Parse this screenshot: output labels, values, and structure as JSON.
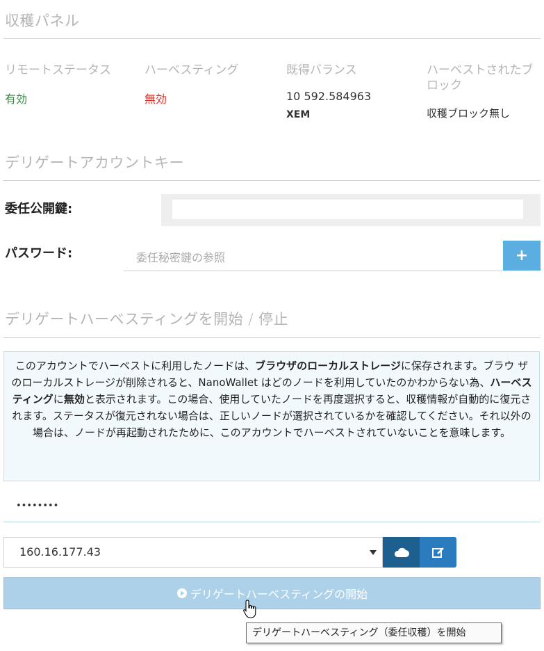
{
  "panel": {
    "title": "収穫パネル"
  },
  "stats": [
    {
      "label": "リモートステータス",
      "value": "有効",
      "sub": ""
    },
    {
      "label": "ハーベスティング",
      "value": "無効",
      "sub": ""
    },
    {
      "label": "既得バランス",
      "value": "10 592.584963",
      "sub": "XEM"
    },
    {
      "label": "ハーベストされたブロック",
      "value": "収穫ブロック無し",
      "sub": ""
    }
  ],
  "delegate": {
    "title": "デリゲートアカウントキー",
    "public_key_label": "委任公開鍵:",
    "public_key_value": "",
    "password_label": "パスワード:",
    "password_placeholder": "委任秘密鍵の参照",
    "plus_symbol": "+"
  },
  "harvest": {
    "title": "デリゲートハーベスティングを開始 / 停止",
    "info": {
      "p1": "このアカウントでハーベストに利用したノードは、",
      "b1": "ブラウザのローカルストレージ",
      "p2": "に保存されます。ブラウ ザのローカルストレージが削除されると、NanoWallet はどのノードを利用していたのかわからない為、",
      "b2": "ハーベスティング",
      "p3": "に",
      "b3": "無効",
      "p4": "と表示されます。この場合、使用していたノードを再度選択すると、収穫情報が自動的に復元されます。ステータスが復元されない場合は、正しいノードが選択されているかを確認してください。それ以外の場合は、ノードが再起動されたために、このアカウントでハーベストされていないことを意味します。"
    },
    "password_dots": "••••••••",
    "node_selected": "160.16.177.43",
    "start_label": "デリゲートハーベスティングの開始",
    "tooltip": "デリゲートハーベスティング（委任収穫）を開始"
  },
  "colors": {
    "active_green": "#2e8b3a",
    "inactive_red": "#e0302a",
    "accent_blue": "#5aaee0",
    "dark_blue": "#1d5f8f"
  }
}
